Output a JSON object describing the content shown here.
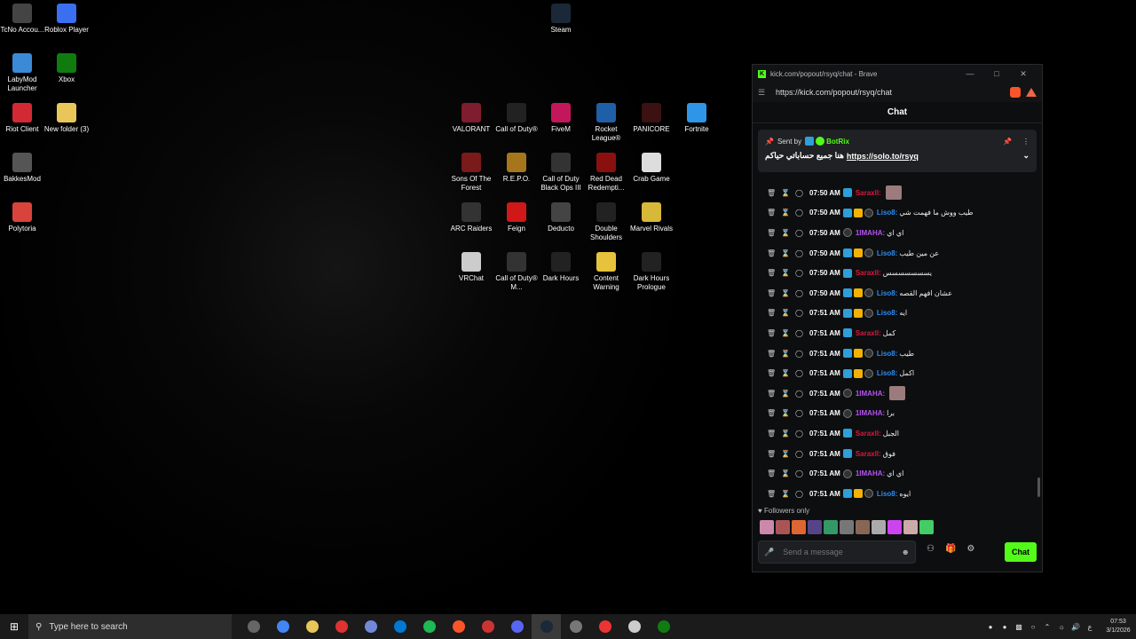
{
  "desktop": {
    "icons": [
      {
        "label": "TcNo Accou...",
        "color": "#444"
      },
      {
        "label": "Roblox Player",
        "color": "#3a6ff0"
      },
      {
        "label": "LabyMod Launcher",
        "color": "#3a8ad8"
      },
      {
        "label": "Xbox",
        "color": "#107c10"
      },
      {
        "label": "Riot Client",
        "color": "#d32935"
      },
      {
        "label": "New folder (3)",
        "color": "#e8c65a"
      },
      {
        "label": "BakkesMod",
        "color": "#555"
      },
      {
        "label": "Polytoria",
        "color": "#d8433c"
      },
      {
        "label": "Steam",
        "color": "#1b2838"
      },
      {
        "label": "VALORANT",
        "color": "#7d1d2d"
      },
      {
        "label": "Call of Duty®",
        "color": "#222"
      },
      {
        "label": "FiveM",
        "color": "#c2185b"
      },
      {
        "label": "Rocket League®",
        "color": "#1e5fa8"
      },
      {
        "label": "PANICORE",
        "color": "#3b1111"
      },
      {
        "label": "Fortnite",
        "color": "#2f95e6"
      },
      {
        "label": "Sons Of The Forest",
        "color": "#7a1a1a"
      },
      {
        "label": "R.E.P.O.",
        "color": "#a5761b"
      },
      {
        "label": "Call of Duty Black Ops III",
        "color": "#333"
      },
      {
        "label": "Red Dead Redempti...",
        "color": "#8a1010"
      },
      {
        "label": "Crab Game",
        "color": "#ddd"
      },
      {
        "label": "ARC Raiders",
        "color": "#333"
      },
      {
        "label": "Feign",
        "color": "#d01818"
      },
      {
        "label": "Deducto",
        "color": "#444"
      },
      {
        "label": "Double Shoulders",
        "color": "#222"
      },
      {
        "label": "Marvel Rivals",
        "color": "#d8b838"
      },
      {
        "label": "VRChat",
        "color": "#ccc"
      },
      {
        "label": "Call of Duty® M...",
        "color": "#333"
      },
      {
        "label": "Dark Hours",
        "color": "#222"
      },
      {
        "label": "Content Warning",
        "color": "#e6c33c"
      },
      {
        "label": "Dark Hours Prologue",
        "color": "#222"
      }
    ]
  },
  "browser": {
    "title": "kick.com/popout/rsyq/chat - Brave",
    "url": "https://kick.com/popout/rsyq/chat",
    "chat_title": "Chat",
    "pinned": {
      "sent_by": "Sent by",
      "user": "BotRix",
      "text": "هنا جميع حساباتي حياكم",
      "link": "https://solo.to/rsyq"
    },
    "messages": [
      {
        "time": "07:50 AM",
        "user": "Saraxll:",
        "color": "#e0163a",
        "text": "",
        "emote": true,
        "badges": [
          "blue"
        ]
      },
      {
        "time": "07:50 AM",
        "user": "Liso8:",
        "color": "#2e8bf0",
        "text": "طيب ووش ما فهمت شي",
        "emote": false,
        "badges": [
          "blue",
          "gold",
          "moon"
        ]
      },
      {
        "time": "07:50 AM",
        "user": "1IMAHA:",
        "color": "#b354f0",
        "text": "اي اي",
        "emote": false,
        "badges": [
          "moon"
        ]
      },
      {
        "time": "07:50 AM",
        "user": "Liso8:",
        "color": "#2e8bf0",
        "text": "عن مين طيب",
        "emote": false,
        "badges": [
          "blue",
          "gold",
          "moon"
        ]
      },
      {
        "time": "07:50 AM",
        "user": "Saraxll:",
        "color": "#e0163a",
        "text": "يسسسسسسس",
        "emote": false,
        "badges": [
          "blue"
        ]
      },
      {
        "time": "07:50 AM",
        "user": "Liso8:",
        "color": "#2e8bf0",
        "text": "عشان افهم القصه",
        "emote": false,
        "badges": [
          "blue",
          "gold",
          "moon"
        ]
      },
      {
        "time": "07:51 AM",
        "user": "Liso8:",
        "color": "#2e8bf0",
        "text": "ايه",
        "emote": false,
        "badges": [
          "blue",
          "gold",
          "moon"
        ]
      },
      {
        "time": "07:51 AM",
        "user": "Saraxll:",
        "color": "#e0163a",
        "text": "كمل",
        "emote": false,
        "badges": [
          "blue"
        ]
      },
      {
        "time": "07:51 AM",
        "user": "Liso8:",
        "color": "#2e8bf0",
        "text": "طيب",
        "emote": false,
        "badges": [
          "blue",
          "gold",
          "moon"
        ]
      },
      {
        "time": "07:51 AM",
        "user": "Liso8:",
        "color": "#2e8bf0",
        "text": "اكمل",
        "emote": false,
        "badges": [
          "blue",
          "gold",
          "moon"
        ]
      },
      {
        "time": "07:51 AM",
        "user": "1IMAHA:",
        "color": "#b354f0",
        "text": "",
        "emote": true,
        "badges": [
          "moon"
        ]
      },
      {
        "time": "07:51 AM",
        "user": "1IMAHA:",
        "color": "#b354f0",
        "text": "برا",
        "emote": false,
        "badges": [
          "moon"
        ]
      },
      {
        "time": "07:51 AM",
        "user": "Saraxll:",
        "color": "#e0163a",
        "text": "الجبل",
        "emote": false,
        "badges": [
          "blue"
        ]
      },
      {
        "time": "07:51 AM",
        "user": "Saraxll:",
        "color": "#e0163a",
        "text": "فوق",
        "emote": false,
        "badges": [
          "blue"
        ]
      },
      {
        "time": "07:51 AM",
        "user": "1IMAHA:",
        "color": "#b354f0",
        "text": "اي اي",
        "emote": false,
        "badges": [
          "moon"
        ]
      },
      {
        "time": "07:51 AM",
        "user": "Liso8:",
        "color": "#2e8bf0",
        "text": "ايوه",
        "emote": false,
        "badges": [
          "blue",
          "gold",
          "moon"
        ]
      }
    ],
    "followers_only": "Followers only",
    "emote_colors": [
      "#c8a",
      "#a55",
      "#d63",
      "#548",
      "#396",
      "#777",
      "#865",
      "#aaa",
      "#c4e",
      "#caa",
      "#4c6"
    ],
    "composer_placeholder": "Send a message",
    "send_label": "Chat",
    "accent": "#53fc18"
  },
  "taskbar": {
    "search_placeholder": "Type here to search",
    "apps": [
      "#666",
      "#4285f4",
      "#e8c65a",
      "#d33",
      "#7289da",
      "#0078d4",
      "#1db954",
      "#fb542b",
      "#c33",
      "#5865f2",
      "#1b2838",
      "#777",
      "#e33",
      "#ccc",
      "#107c10"
    ],
    "time": "07:53",
    "date": "3/1/2026",
    "lang": "ع"
  }
}
